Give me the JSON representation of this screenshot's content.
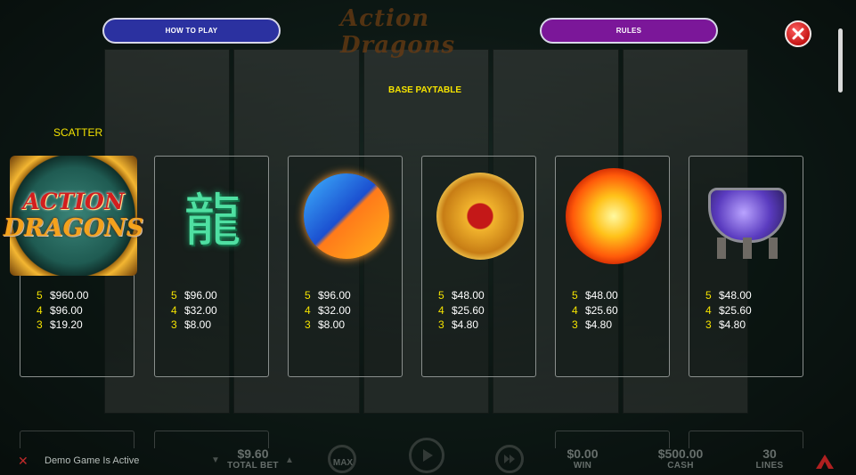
{
  "game": {
    "title": "Action Dragons"
  },
  "header": {
    "how_to_play": "HOW TO PLAY",
    "rules": "RULES",
    "close_icon": "close-x-icon"
  },
  "paytable": {
    "title": "BASE PAYTABLE",
    "scatter_label": "SCATTER",
    "symbols": [
      {
        "name": "action-dragons-scatter",
        "art_line1": "ACTION",
        "art_line2": "DRAGONS",
        "pays": [
          {
            "count": "5",
            "amount": "$960.00"
          },
          {
            "count": "4",
            "amount": "$96.00"
          },
          {
            "count": "3",
            "amount": "$19.20"
          }
        ]
      },
      {
        "name": "jade-dragon-character",
        "glyph": "龍",
        "pays": [
          {
            "count": "5",
            "amount": "$96.00"
          },
          {
            "count": "4",
            "amount": "$32.00"
          },
          {
            "count": "3",
            "amount": "$8.00"
          }
        ]
      },
      {
        "name": "yin-yang-orb",
        "pays": [
          {
            "count": "5",
            "amount": "$96.00"
          },
          {
            "count": "4",
            "amount": "$32.00"
          },
          {
            "count": "3",
            "amount": "$8.00"
          }
        ]
      },
      {
        "name": "red-ribbon-coin",
        "pays": [
          {
            "count": "5",
            "amount": "$48.00"
          },
          {
            "count": "4",
            "amount": "$25.60"
          },
          {
            "count": "3",
            "amount": "$4.80"
          }
        ]
      },
      {
        "name": "fireball",
        "pays": [
          {
            "count": "5",
            "amount": "$48.00"
          },
          {
            "count": "4",
            "amount": "$25.60"
          },
          {
            "count": "3",
            "amount": "$4.80"
          }
        ]
      },
      {
        "name": "purple-cauldron",
        "pays": [
          {
            "count": "5",
            "amount": "$48.00"
          },
          {
            "count": "4",
            "amount": "$25.60"
          },
          {
            "count": "3",
            "amount": "$4.80"
          }
        ]
      }
    ]
  },
  "footer": {
    "status": "Demo Game Is Active",
    "total_bet_value": "$9.60",
    "total_bet_label": "TOTAL BET",
    "max_label": "MAX",
    "win_value": "$0.00",
    "win_label": "WIN",
    "cash_value": "$500.00",
    "cash_label": "CASH",
    "lines_value": "30",
    "lines_label": "LINES"
  },
  "colors": {
    "accent_yellow": "#f5e300",
    "how_to_play_bg": "#2b31a0",
    "rules_bg": "#7b1799",
    "close_red": "#c41414"
  }
}
